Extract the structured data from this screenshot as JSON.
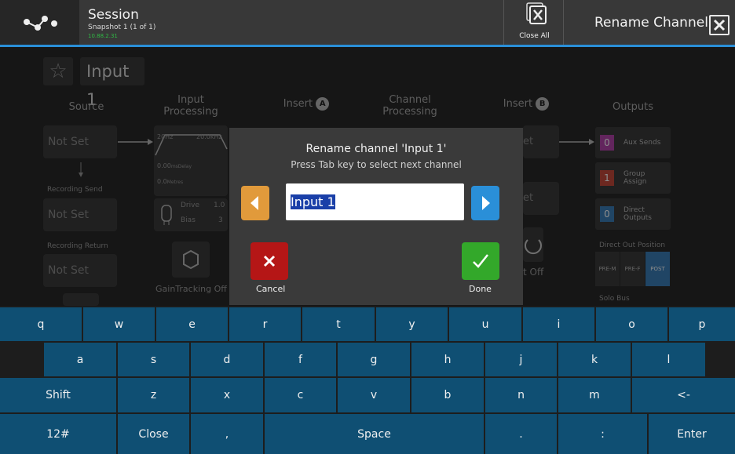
{
  "header": {
    "session_title": "Session",
    "snapshot_text": "Snapshot 1 (1 of 1)",
    "ip_text": "10.88.2.31",
    "close_all_label": "Close All",
    "rename_title": "Rename Channel",
    "accent_color": "#2a8fd8"
  },
  "channel": {
    "name": "Input 1",
    "columns": {
      "source": "Source",
      "input_processing": "Input Processing",
      "insert_a": "Insert",
      "insert_a_badge": "A",
      "channel_processing": "Channel Processing",
      "insert_b": "Insert",
      "insert_b_badge": "B",
      "outputs": "Outputs"
    },
    "source_value": "Not Set",
    "recording_send_label": "Recording Send",
    "recording_send_value": "Not Set",
    "recording_return_label": "Recording Return",
    "recording_return_value": "Not Set",
    "filter_low": "20Hz",
    "filter_high": "20.0kHz",
    "delay_ms": "0.00",
    "delay_unit": "msDelay",
    "delay_metres": "0.0",
    "metres_unit": "Metres",
    "drive_label": "Drive",
    "drive_value": "1.0",
    "bias_label": "Bias",
    "bias_value": "3",
    "gain_tracking_label": "GainTracking Off",
    "insert_b_partial_1": "et",
    "insert_b_partial_2": "et",
    "insert_b_partial_off": "t Off",
    "outputs_items": [
      {
        "num": "0",
        "label": "Aux Sends",
        "color": "#a3339a"
      },
      {
        "num": "1",
        "label": "Group Assign",
        "color": "#b53a2a"
      },
      {
        "num": "0",
        "label": "Direct Outputs",
        "color": "#2a6ea8"
      }
    ],
    "direct_out_label": "Direct Out Position",
    "direct_out_options": [
      "PRE-M",
      "PRE-F",
      "POST"
    ],
    "solo_bus_label": "Solo Bus"
  },
  "dialog": {
    "title": "Rename channel 'Input 1'",
    "subtitle": "Press Tab key to select next channel",
    "input_value": "Input 1",
    "cancel_label": "Cancel",
    "done_label": "Done"
  },
  "keyboard": {
    "row1": [
      "q",
      "w",
      "e",
      "r",
      "t",
      "y",
      "u",
      "i",
      "o",
      "p"
    ],
    "row2": [
      "a",
      "s",
      "d",
      "f",
      "g",
      "h",
      "j",
      "k",
      "l"
    ],
    "row3": [
      "Shift",
      "z",
      "x",
      "c",
      "v",
      "b",
      "n",
      "m",
      "<-"
    ],
    "row4": [
      "12#",
      "Close",
      ",",
      "Space",
      ".",
      ":",
      "Enter"
    ]
  }
}
